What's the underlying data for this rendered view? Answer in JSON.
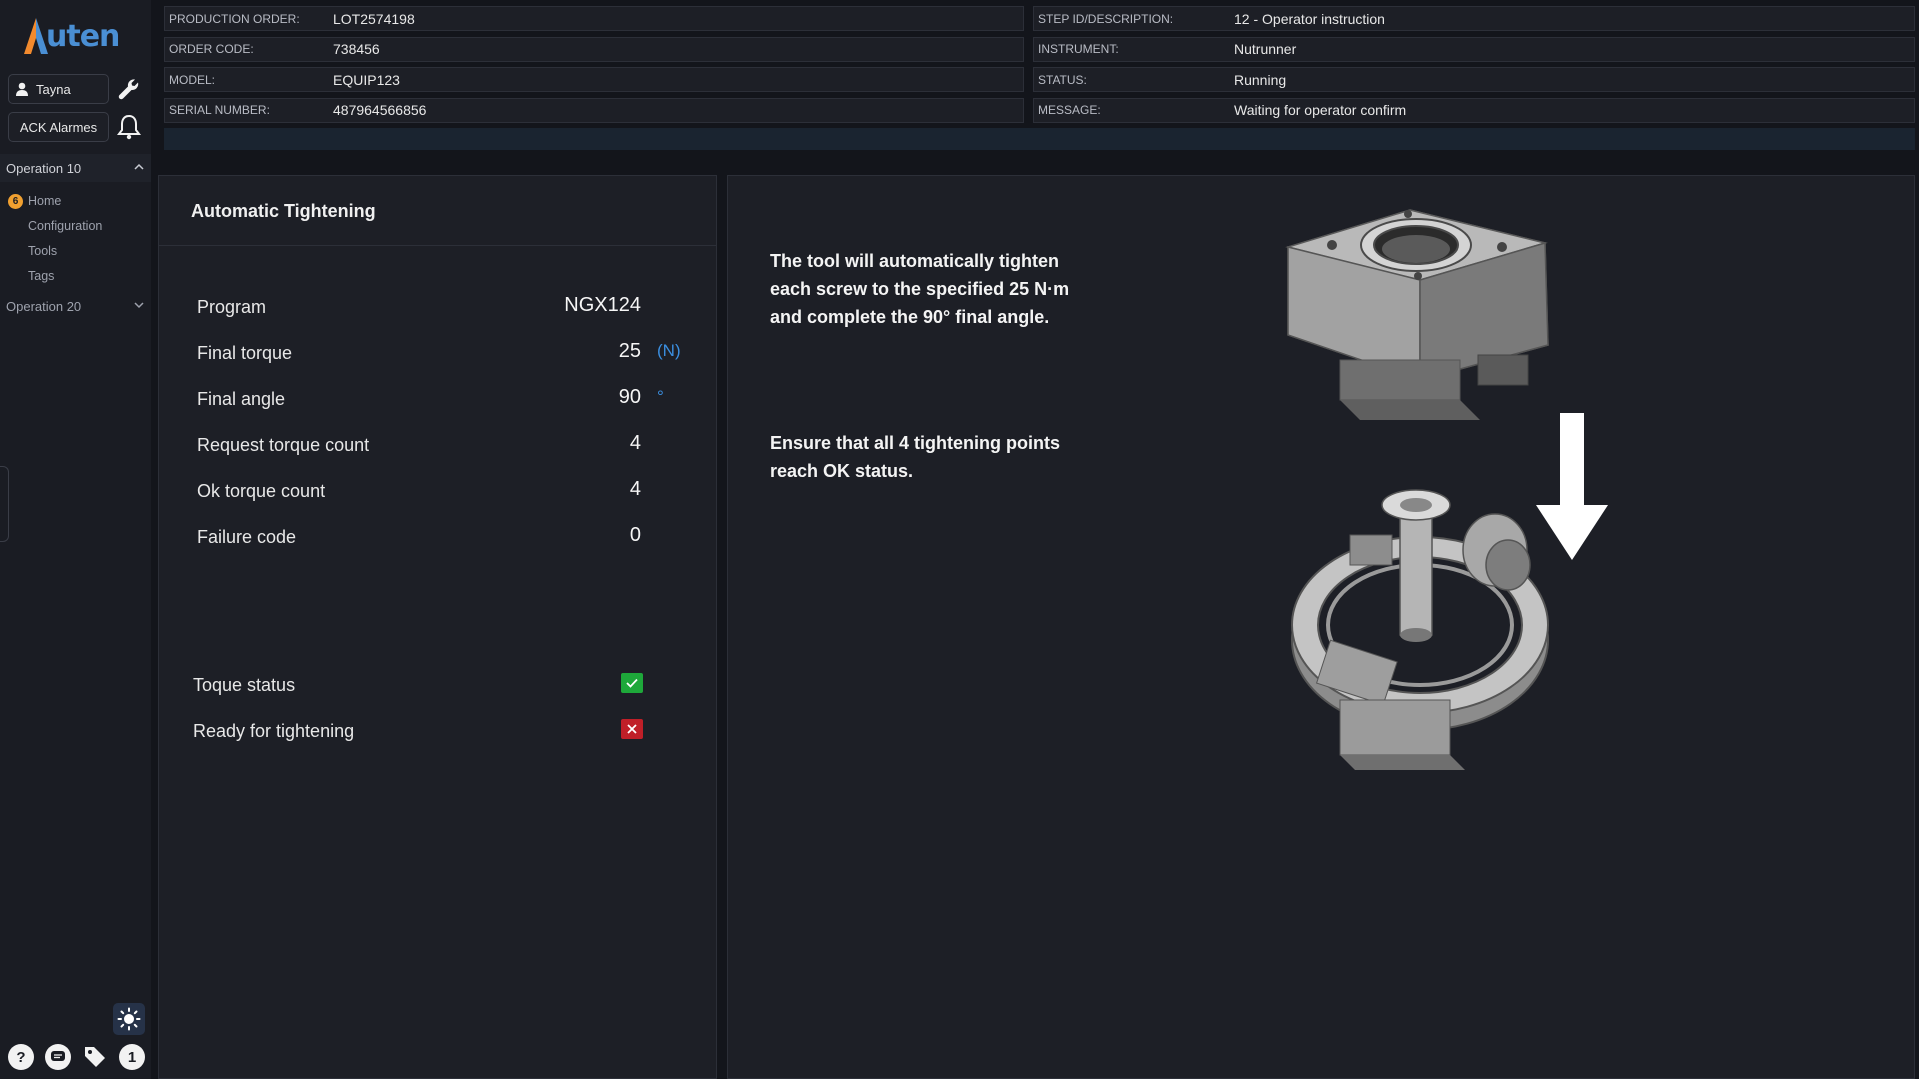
{
  "app": {
    "logo_text": "Auten"
  },
  "sidebar": {
    "user_name": "Tayna",
    "ack_label": "ACK Alarmes",
    "groups": [
      {
        "label": "Operation 10",
        "items": [
          "Home",
          "Configuration",
          "Tools",
          "Tags"
        ],
        "home_badge": "6"
      },
      {
        "label": "Operation 20"
      }
    ],
    "bottom_badge": "1"
  },
  "header": {
    "left": [
      {
        "label": "PRODUCTION ORDER:",
        "value": "LOT2574198"
      },
      {
        "label": "ORDER CODE:",
        "value": "738456"
      },
      {
        "label": "MODEL:",
        "value": "EQUIP123"
      },
      {
        "label": "SERIAL NUMBER:",
        "value": "487964566856"
      }
    ],
    "right": [
      {
        "label": "STEP ID/DESCRIPTION:",
        "value": "12 - Operator instruction"
      },
      {
        "label": "INSTRUMENT:",
        "value": "Nutrunner"
      },
      {
        "label": "STATUS:",
        "value": "Running"
      },
      {
        "label": "MESSAGE:",
        "value": "Waiting for operator confirm"
      }
    ]
  },
  "tightening": {
    "title": "Automatic Tightening",
    "params": [
      {
        "label": "Program",
        "value": "NGX124",
        "unit": ""
      },
      {
        "label": "Final torque",
        "value": "25",
        "unit": "(N)"
      },
      {
        "label": "Final angle",
        "value": "90",
        "unit": "°"
      },
      {
        "label": "Request torque count",
        "value": "4",
        "unit": ""
      },
      {
        "label": "Ok torque count",
        "value": "4",
        "unit": ""
      },
      {
        "label": "Failure code",
        "value": "0",
        "unit": ""
      }
    ],
    "status": [
      {
        "label": "Toque status",
        "state": "ok"
      },
      {
        "label": "Ready for tightening",
        "state": "fail"
      }
    ]
  },
  "instructions": {
    "para1": [
      "The tool will automatically tighten",
      "each screw to the specified 25 N·m",
      "and complete the 90° final angle."
    ],
    "para2": [
      "Ensure that all 4 tightening points",
      "reach OK status."
    ]
  },
  "colors": {
    "accent": "#3b8fe0",
    "ok": "#1ea83a",
    "fail": "#c01f28",
    "badge": "#f0a030"
  }
}
